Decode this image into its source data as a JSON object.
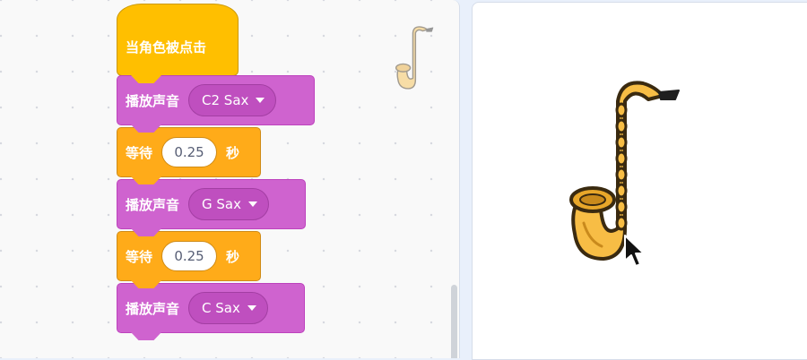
{
  "code_area": {
    "sprite_thumbnail": "saxophone-icon"
  },
  "script": {
    "hat_label": "当角色被点击",
    "blocks": [
      {
        "kind": "play_sound",
        "label": "播放声音",
        "sound": "C2 Sax"
      },
      {
        "kind": "wait",
        "label": "等待",
        "seconds": "0.25",
        "unit": "秒"
      },
      {
        "kind": "play_sound",
        "label": "播放声音",
        "sound": "G Sax"
      },
      {
        "kind": "wait",
        "label": "等待",
        "seconds": "0.25",
        "unit": "秒"
      },
      {
        "kind": "play_sound",
        "label": "播放声音",
        "sound": "C Sax"
      }
    ]
  },
  "stage": {
    "sprite": "saxophone-icon",
    "cursor": "arrow-cursor-icon"
  },
  "colors": {
    "events_block": "#ffbf00",
    "sound_block": "#cf63cf",
    "control_block": "#ffab19",
    "code_background": "#f9f9f9",
    "stage_background": "#ffffff"
  }
}
